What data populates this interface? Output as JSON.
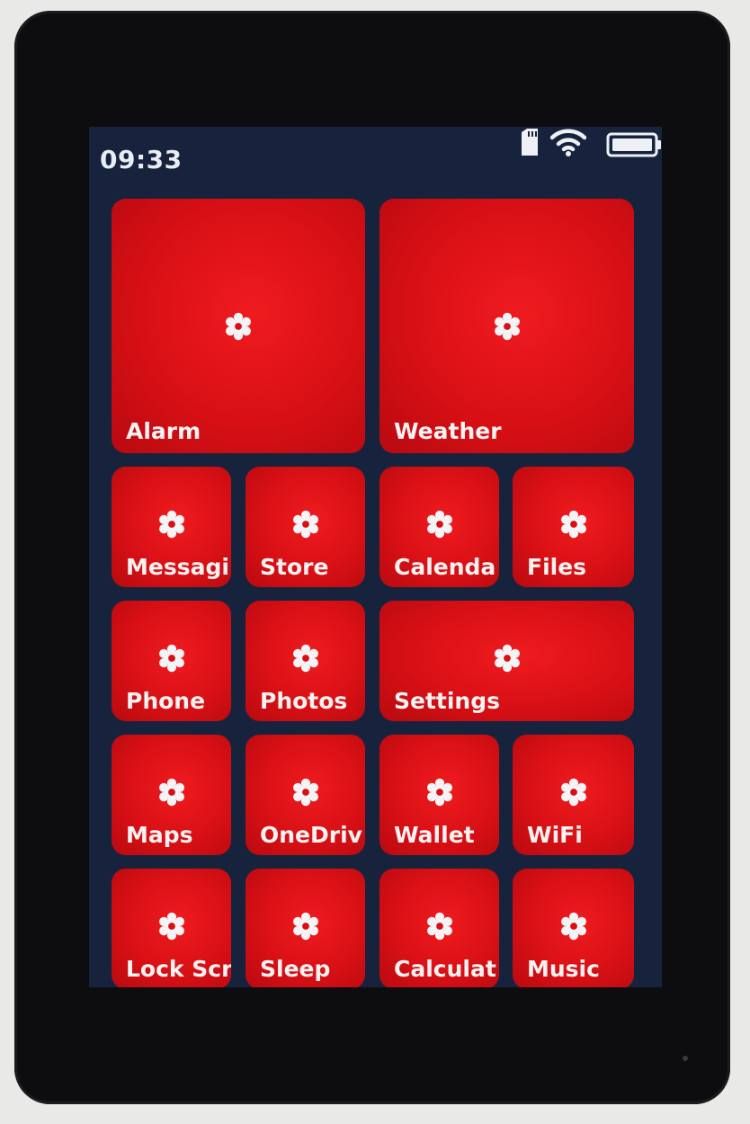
{
  "status_bar": {
    "time": "09:33",
    "icons": [
      "sd-card-icon",
      "wifi-icon",
      "battery-icon"
    ]
  },
  "colors": {
    "tile": "#d81015",
    "background": "#17233d",
    "text": "#f6f2f2"
  },
  "tiles": [
    {
      "label": "Alarm",
      "icon": "gear-icon"
    },
    {
      "label": "Weather",
      "icon": "gear-icon"
    },
    {
      "label": "Messagi",
      "icon": "gear-icon"
    },
    {
      "label": "Store",
      "icon": "gear-icon"
    },
    {
      "label": "Calenda",
      "icon": "gear-icon"
    },
    {
      "label": "Files",
      "icon": "gear-icon"
    },
    {
      "label": "Phone",
      "icon": "gear-icon"
    },
    {
      "label": "Photos",
      "icon": "gear-icon"
    },
    {
      "label": "Settings",
      "icon": "gear-icon"
    },
    {
      "label": "Maps",
      "icon": "gear-icon"
    },
    {
      "label": "OneDriv",
      "icon": "gear-icon"
    },
    {
      "label": "Wallet",
      "icon": "gear-icon"
    },
    {
      "label": "WiFi",
      "icon": "gear-icon"
    },
    {
      "label": "Lock Scr",
      "icon": "gear-icon"
    },
    {
      "label": "Sleep",
      "icon": "gear-icon"
    },
    {
      "label": "Calculat",
      "icon": "gear-icon"
    },
    {
      "label": "Music",
      "icon": "gear-icon"
    }
  ]
}
